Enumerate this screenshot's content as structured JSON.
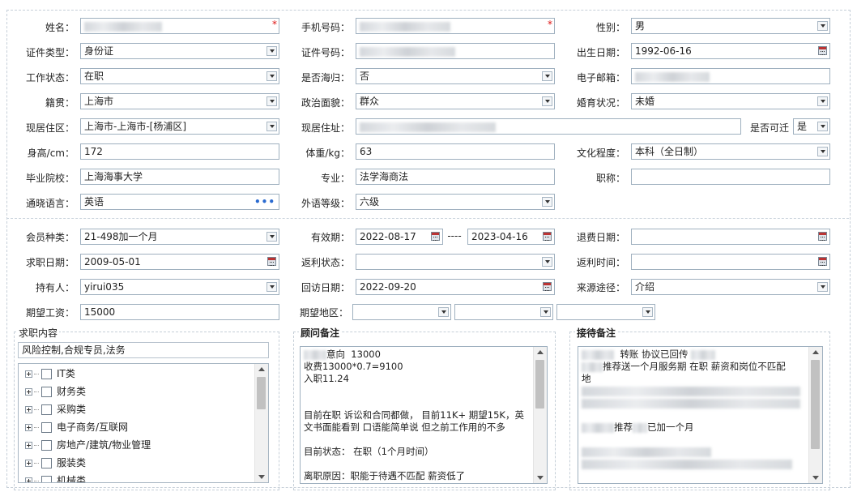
{
  "personal": {
    "name": {
      "label": "姓名：",
      "required": "*"
    },
    "phone": {
      "label": "手机号码：",
      "required": "*"
    },
    "gender": {
      "label": "性别：",
      "value": "男"
    },
    "id_type": {
      "label": "证件类型：",
      "value": "身份证"
    },
    "id_number": {
      "label": "证件号码："
    },
    "birth_date": {
      "label": "出生日期：",
      "value": "1992-06-16"
    },
    "work_status": {
      "label": "工作状态：",
      "value": "在职"
    },
    "returnee": {
      "label": "是否海归：",
      "value": "否"
    },
    "email": {
      "label": "电子邮箱："
    },
    "native_place": {
      "label": "籍贯：",
      "value": "上海市"
    },
    "political": {
      "label": "政治面貌：",
      "value": "群众"
    },
    "marital": {
      "label": "婚育状况：",
      "value": "未婚"
    },
    "residence_area": {
      "label": "现居住区：",
      "value": "上海市-上海市-[杨浦区]"
    },
    "address": {
      "label": "现居住址："
    },
    "relocate": {
      "label": "是否可迁",
      "value": "是"
    },
    "height": {
      "label": "身高/cm：",
      "value": "172"
    },
    "weight": {
      "label": "体重/kg：",
      "value": "63"
    },
    "education": {
      "label": "文化程度：",
      "value": "本科（全日制）"
    },
    "school": {
      "label": "毕业院校：",
      "value": "上海海事大学"
    },
    "major": {
      "label": "专业：",
      "value": "法学海商法"
    },
    "job_title": {
      "label": "职称：",
      "value": ""
    },
    "language": {
      "label": "通晓语言：",
      "value": "英语",
      "more": "•••"
    },
    "lang_level": {
      "label": "外语等级：",
      "value": "六级"
    }
  },
  "membership": {
    "member_type": {
      "label": "会员种类：",
      "value": "21-498加一个月"
    },
    "validity": {
      "label": "有效期：",
      "start": "2022-08-17",
      "sep": "----",
      "end": "2023-04-16"
    },
    "refund_date": {
      "label": "退费日期：",
      "value": ""
    },
    "job_date": {
      "label": "求职日期：",
      "value": "2009-05-01"
    },
    "rebate_status": {
      "label": "返利状态：",
      "value": ""
    },
    "rebate_time": {
      "label": "返利时间：",
      "value": ""
    },
    "holder": {
      "label": "持有人：",
      "value": "yirui035"
    },
    "visit_date": {
      "label": "回访日期：",
      "value": "2022-09-20"
    },
    "source": {
      "label": "来源途径：",
      "value": "介绍"
    },
    "expected_salary": {
      "label": "期望工资：",
      "value": "15000"
    },
    "expected_area": {
      "label": "期望地区："
    }
  },
  "job_content": {
    "title": "求职内容",
    "selected": "风险控制,合规专员,法务",
    "tree": [
      "IT类",
      "财务类",
      "采购类",
      "电子商务/互联网",
      "房地产/建筑/物业管理",
      "服装类",
      "机械类"
    ]
  },
  "advisor_notes": {
    "title": "顾问备注",
    "lines": [
      "意向  13000",
      "收费13000*0.7=9100",
      "入职11.24",
      "",
      "",
      "目前在职 诉讼和合同都做， 目前11K+ 期望15K，英",
      "文书面能看到 口语能简单说 但之前工作用的不多",
      "",
      "目前状态： 在职（1个月时间）",
      "",
      "离职原因：职能于待遇不匹配 薪资低了"
    ]
  },
  "reception_notes": {
    "title": "接待备注",
    "line1": "转账 协议已回传",
    "line2": "推荐送一个月服务期 在职 薪资和岗位不匹配",
    "line3": "地",
    "line4": "推荐",
    "line4b": "已加一个月"
  }
}
